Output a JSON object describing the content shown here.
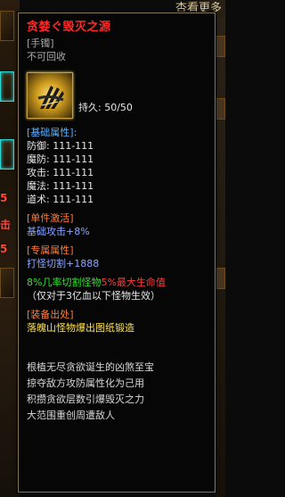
{
  "background": {
    "top_right_text": "杏看更多",
    "left_red_marks": [
      "5",
      "击",
      "5"
    ]
  },
  "item": {
    "name": "贪婪ぐ毁灭之源",
    "type": "[手镯]",
    "bind_status": "不可回收",
    "durability_label": "持久:",
    "durability_value": "50/50"
  },
  "base_attributes": {
    "header": "[基础属性]:",
    "rows": [
      {
        "label": "防御:",
        "value": "111-111"
      },
      {
        "label": "魔防:",
        "value": "111-111"
      },
      {
        "label": "攻击:",
        "value": "111-111"
      },
      {
        "label": "魔法:",
        "value": "111-111"
      },
      {
        "label": "道术:",
        "value": "111-111"
      }
    ]
  },
  "activation": {
    "header": "[单件激活]",
    "text": "基础攻击+8%"
  },
  "exclusive": {
    "header": "[专属属性]",
    "text": "打怪切割+1888"
  },
  "special": {
    "line1_green": "8%几率切割怪物",
    "line1_red": "5%最大生命值",
    "line2": "（仅对于3亿血以下怪物生效）"
  },
  "source": {
    "header": "[装备出处]",
    "text": "落魄山怪物爆出图纸锻造"
  },
  "description": [
    "根植无尽贪欲诞生的凶煞至宝",
    "掠夺敌方攻防属性化为己用",
    "积攒贪欲层数引爆毁灭之力",
    "大范围重创周遭敌人"
  ],
  "colors": {
    "title": "#ff2a2a",
    "header_cyan": "#5ab0ff",
    "header_orange": "#ff7a3a",
    "source_yellow": "#ffe14a",
    "special_green": "#33e033",
    "special_red": "#ff3a3a"
  },
  "icons": {
    "item_icon": "claw-bracelet-icon"
  }
}
